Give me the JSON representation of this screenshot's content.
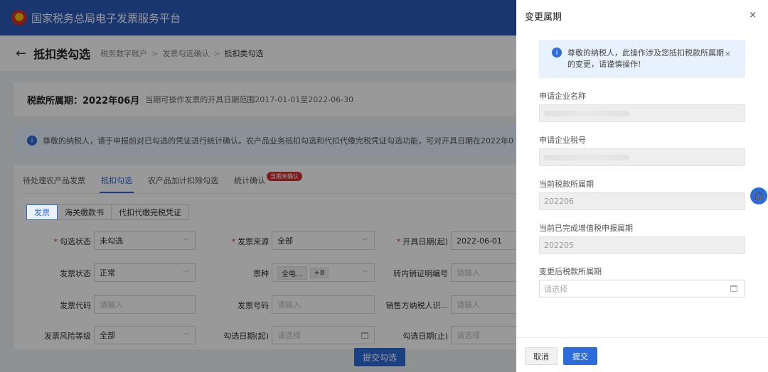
{
  "app": {
    "title": "国家税务总局电子发票服务平台"
  },
  "header": {
    "back_icon": "←",
    "page_title": "抵扣类勾选",
    "breadcrumbs": [
      "税务数字账户",
      "发票勾选确认",
      "抵扣类勾选"
    ],
    "crumb_sep": ">"
  },
  "period": {
    "label": "税款所属期：",
    "value": "2022年06月",
    "range_text": "当期可操作发票的开具日期范围2017-01-01至2022-06-30"
  },
  "notice": {
    "text": "尊敬的纳税人，请于申报前对已勾选的凭证进行统计确认。农产品业务抵扣勾选和代扣代缴完税凭证勾选功能，可对开具日期在2022年0"
  },
  "tabs": [
    {
      "label": "待处理农产品发票"
    },
    {
      "label": "抵扣勾选"
    },
    {
      "label": "农产品加计扣除勾选"
    },
    {
      "label": "统计确认"
    }
  ],
  "tab_badge": "当期未确认",
  "segments": [
    "发票",
    "海关缴款书",
    "代扣代缴完税凭证"
  ],
  "form": {
    "select_status": {
      "label": "勾选状态",
      "value": "未勾选"
    },
    "invoice_source": {
      "label": "发票来源",
      "value": "全部"
    },
    "issue_date_start": {
      "label": "开具日期(起)",
      "value": "2022-06-01"
    },
    "invoice_status": {
      "label": "发票状态",
      "value": "正常"
    },
    "invoice_type": {
      "label": "票种",
      "tag": "全电...",
      "more": "+8"
    },
    "transfer_cert_no": {
      "label": "转内销证明编号",
      "placeholder": "请输入"
    },
    "invoice_code": {
      "label": "发票代码",
      "placeholder": "请输入"
    },
    "invoice_number": {
      "label": "发票号码",
      "placeholder": "请输入"
    },
    "seller_tax_id": {
      "label": "销售方纳税人识...",
      "placeholder": "请输入"
    },
    "risk_level": {
      "label": "发票风险等级",
      "value": "全部"
    },
    "select_date_start": {
      "label": "勾选日期(起)",
      "placeholder": "请选择"
    },
    "select_date_end": {
      "label": "勾选日期(止)",
      "placeholder": "请选择"
    }
  },
  "main_submit": "提交勾选",
  "drawer": {
    "title": "变更属期",
    "close": "×",
    "alert_text": "尊敬的纳税人，此操作涉及您抵扣税款所属期的变更，请谨慎操作!",
    "alert_close": "×",
    "company_name_label": "申请企业名称",
    "company_tax_id_label": "申请企业税号",
    "current_period_label": "当前税款所属期",
    "current_period_value": "202206",
    "completed_period_label": "当前已完成增值税申报属期",
    "completed_period_value": "202205",
    "new_period_label": "变更后税款所属期",
    "new_period_placeholder": "请选择",
    "cancel": "取消",
    "submit": "提交"
  },
  "colors": {
    "primary": "#2c6bd9",
    "header": "#2c5bbd",
    "badge": "#d32f2f",
    "notice_bg": "#e8f2fe"
  }
}
